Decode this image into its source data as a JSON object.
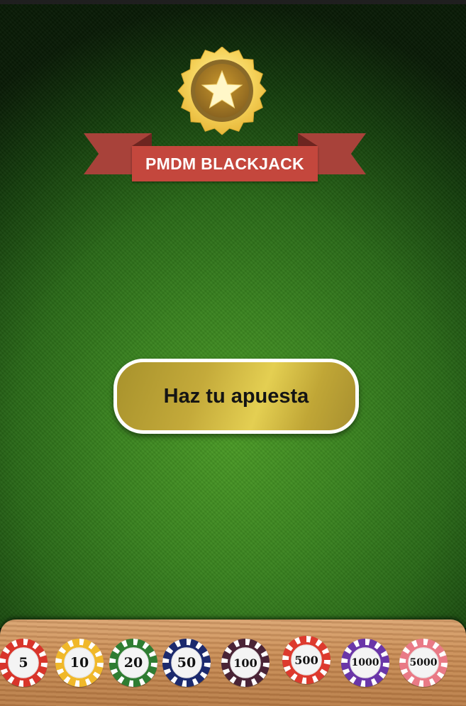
{
  "title": "PMDM BLACKJACK",
  "bet_button": {
    "label": "Haz tu apuesta"
  },
  "colors": {
    "felt": "#3a8420",
    "ribbon": "#c4473d",
    "button_gold": "#d4bc48",
    "rail_wood": "#c98e58"
  },
  "badge": {
    "icon": "star-medal-icon"
  },
  "chips": [
    {
      "value": "5",
      "color": "#d8352b"
    },
    {
      "value": "10",
      "color": "#f0b82a"
    },
    {
      "value": "20",
      "color": "#2f7d32"
    },
    {
      "value": "50",
      "color": "#1c2a6e"
    },
    {
      "value": "100",
      "color": "#4a2436"
    },
    {
      "value": "500",
      "color": "#dd3a2e"
    },
    {
      "value": "1000",
      "color": "#6a36a8"
    },
    {
      "value": "5000",
      "color": "#e97a86"
    }
  ]
}
